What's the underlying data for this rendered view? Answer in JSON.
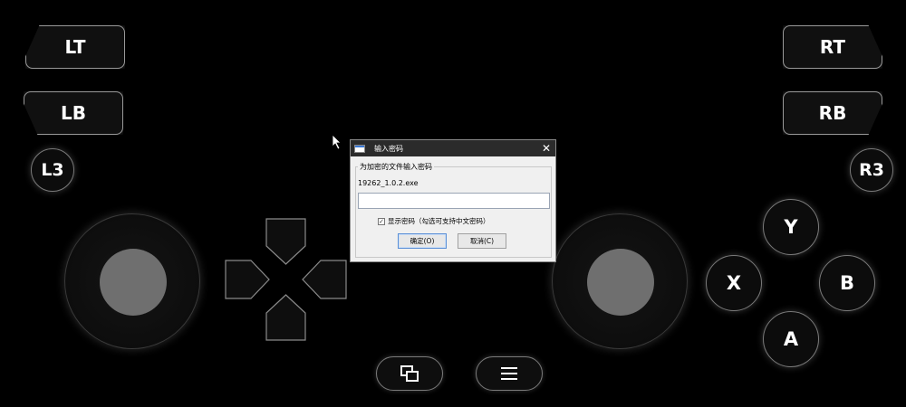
{
  "gamepad": {
    "lt": "LT",
    "lb": "LB",
    "rt": "RT",
    "rb": "RB",
    "l3": "L3",
    "r3": "R3",
    "face": {
      "y": "Y",
      "x": "X",
      "b": "B",
      "a": "A"
    },
    "icons": {
      "view": "view-icon",
      "menu": "menu-icon",
      "dpad": "dpad-icon"
    }
  },
  "dialog": {
    "title": "输入密码",
    "close_glyph": "✕",
    "group_label": "为加密的文件输入密码",
    "filename": "19262_1.0.2.exe",
    "password_value": "",
    "show_password_label": "显示密码（勾选可支持中文密码）",
    "show_password_checked": true,
    "ok_label": "确定(O)",
    "cancel_label": "取消(C)"
  },
  "colors": {
    "background": "#000000",
    "button_fill": "#101010",
    "button_border": "#9a9a9a",
    "stick_knob": "#6f6f6f",
    "dialog_bg": "#f0f0f0",
    "dialog_titlebar": "#2b2b2b"
  }
}
